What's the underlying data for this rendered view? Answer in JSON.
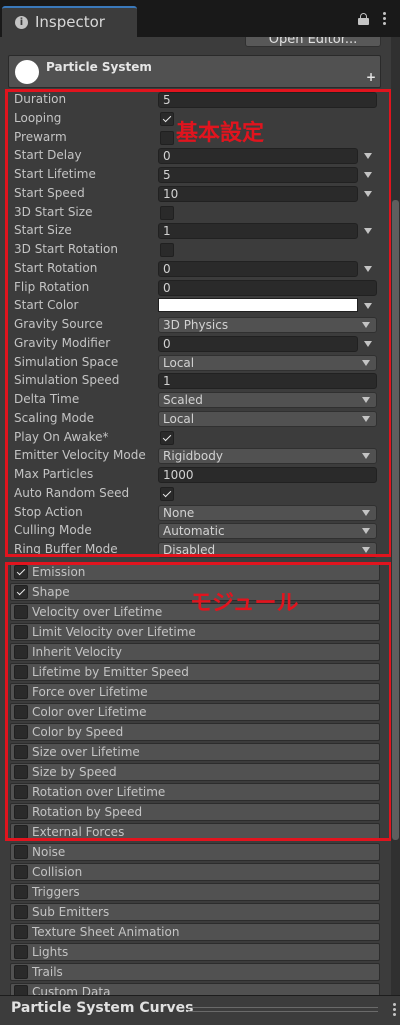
{
  "window": {
    "tab_title": "Inspector",
    "tab_icon": "info-icon",
    "header_icons": [
      "lock-icon",
      "menu-icon"
    ]
  },
  "toolbar": {
    "open_editor_label": "Open Editor..."
  },
  "component": {
    "title": "Particle System",
    "icon": "particle-circle-icon",
    "add_icon": "plus-icon"
  },
  "properties": [
    {
      "label": "Duration",
      "type": "text",
      "value": "5"
    },
    {
      "label": "Looping",
      "type": "toggle",
      "checked": true
    },
    {
      "label": "Prewarm",
      "type": "toggle",
      "checked": false
    },
    {
      "label": "Start Delay",
      "type": "curve",
      "value": "0"
    },
    {
      "label": "Start Lifetime",
      "type": "curve",
      "value": "5"
    },
    {
      "label": "Start Speed",
      "type": "curve",
      "value": "10"
    },
    {
      "label": "3D Start Size",
      "type": "toggle",
      "checked": false
    },
    {
      "label": "Start Size",
      "type": "curve",
      "value": "1"
    },
    {
      "label": "3D Start Rotation",
      "type": "toggle",
      "checked": false
    },
    {
      "label": "Start Rotation",
      "type": "curve",
      "value": "0"
    },
    {
      "label": "Flip Rotation",
      "type": "text",
      "value": "0"
    },
    {
      "label": "Start Color",
      "type": "color",
      "value": "#ffffff"
    },
    {
      "label": "Gravity Source",
      "type": "dropdown",
      "value": "3D Physics"
    },
    {
      "label": "Gravity Modifier",
      "type": "curve",
      "value": "0"
    },
    {
      "label": "Simulation Space",
      "type": "dropdown",
      "value": "Local"
    },
    {
      "label": "Simulation Speed",
      "type": "text",
      "value": "1"
    },
    {
      "label": "Delta Time",
      "type": "dropdown",
      "value": "Scaled"
    },
    {
      "label": "Scaling Mode",
      "type": "dropdown",
      "value": "Local"
    },
    {
      "label": "Play On Awake*",
      "type": "toggle",
      "checked": true
    },
    {
      "label": "Emitter Velocity Mode",
      "type": "dropdown",
      "value": "Rigidbody"
    },
    {
      "label": "Max Particles",
      "type": "text",
      "value": "1000"
    },
    {
      "label": "Auto Random Seed",
      "type": "toggle",
      "checked": true
    },
    {
      "label": "Stop Action",
      "type": "dropdown",
      "value": "None"
    },
    {
      "label": "Culling Mode",
      "type": "dropdown",
      "value": "Automatic"
    },
    {
      "label": "Ring Buffer Mode",
      "type": "dropdown",
      "value": "Disabled"
    }
  ],
  "modules": [
    {
      "label": "Emission",
      "checked": true
    },
    {
      "label": "Shape",
      "checked": true
    },
    {
      "label": "Velocity over Lifetime",
      "checked": false
    },
    {
      "label": "Limit Velocity over Lifetime",
      "checked": false
    },
    {
      "label": "Inherit Velocity",
      "checked": false
    },
    {
      "label": "Lifetime by Emitter Speed",
      "checked": false
    },
    {
      "label": "Force over Lifetime",
      "checked": false
    },
    {
      "label": "Color over Lifetime",
      "checked": false
    },
    {
      "label": "Color by Speed",
      "checked": false
    },
    {
      "label": "Size over Lifetime",
      "checked": false
    },
    {
      "label": "Size by Speed",
      "checked": false
    },
    {
      "label": "Rotation over Lifetime",
      "checked": false
    },
    {
      "label": "Rotation by Speed",
      "checked": false
    },
    {
      "label": "External Forces",
      "checked": false
    },
    {
      "label": "Noise",
      "checked": false
    },
    {
      "label": "Collision",
      "checked": false
    },
    {
      "label": "Triggers",
      "checked": false
    },
    {
      "label": "Sub Emitters",
      "checked": false
    },
    {
      "label": "Texture Sheet Animation",
      "checked": false
    },
    {
      "label": "Lights",
      "checked": false
    },
    {
      "label": "Trails",
      "checked": false
    },
    {
      "label": "Custom Data",
      "checked": false
    }
  ],
  "annotations": {
    "basic_settings": "基本設定",
    "modules": "モジュール",
    "color": "#e1141e"
  },
  "curves_panel": {
    "title": "Particle System Curves"
  },
  "colors": {
    "panel_bg": "#3c3c3c",
    "field_bg": "#2a2a2a",
    "dropdown_bg": "#515151",
    "accent": "#3a79bb"
  }
}
